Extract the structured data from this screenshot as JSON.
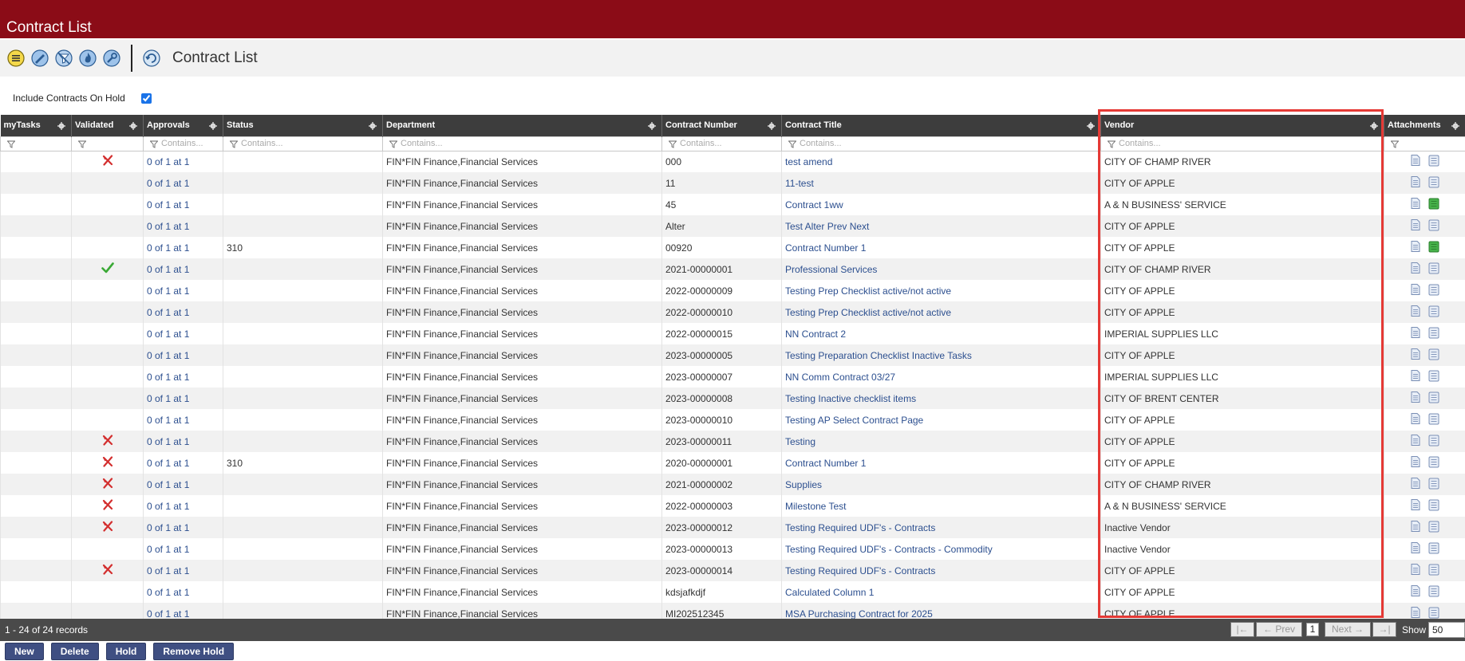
{
  "app": {
    "title": "Contract List"
  },
  "toolbar": {
    "title": "Contract List",
    "icons": [
      "list-icon",
      "edit-pencil-icon",
      "clear-filter-icon",
      "flame-icon",
      "wrench-icon",
      "refresh-icon"
    ]
  },
  "options": {
    "include_on_hold_label": "Include Contracts On Hold",
    "include_on_hold_checked": true
  },
  "grid": {
    "columns": [
      "myTasks",
      "Validated",
      "Approvals",
      "Status",
      "Department",
      "Contract Number",
      "Contract Title",
      "Vendor",
      "Attachments"
    ],
    "filter_placeholder": "Contains...",
    "rows": [
      {
        "validated": "x",
        "approvals": "0 of 1 at 1",
        "status": "",
        "department": "FIN*FIN Finance,Financial Services",
        "number": "000",
        "title": "test amend",
        "vendor": "CITY OF CHAMP RIVER",
        "att2": "gray"
      },
      {
        "validated": "",
        "approvals": "0 of 1 at 1",
        "status": "",
        "department": "FIN*FIN Finance,Financial Services",
        "number": "11",
        "title": "11-test",
        "vendor": "CITY OF APPLE",
        "att2": "gray"
      },
      {
        "validated": "",
        "approvals": "0 of 1 at 1",
        "status": "",
        "department": "FIN*FIN Finance,Financial Services",
        "number": "45",
        "title": "Contract 1ww",
        "vendor": "A & N BUSINESS' SERVICE",
        "att2": "green"
      },
      {
        "validated": "",
        "approvals": "0 of 1 at 1",
        "status": "",
        "department": "FIN*FIN Finance,Financial Services",
        "number": "Alter",
        "title": "Test Alter Prev Next",
        "vendor": "CITY OF APPLE",
        "att2": "gray"
      },
      {
        "validated": "",
        "approvals": "0 of 1 at 1",
        "status": "310",
        "department": "FIN*FIN Finance,Financial Services",
        "number": "00920",
        "title": "Contract Number 1",
        "vendor": "CITY OF APPLE",
        "att2": "green"
      },
      {
        "validated": "check",
        "approvals": "0 of 1 at 1",
        "status": "",
        "department": "FIN*FIN Finance,Financial Services",
        "number": "2021-00000001",
        "title": "Professional Services",
        "vendor": "CITY OF CHAMP RIVER",
        "att2": "gray"
      },
      {
        "validated": "",
        "approvals": "0 of 1 at 1",
        "status": "",
        "department": "FIN*FIN Finance,Financial Services",
        "number": "2022-00000009",
        "title": "Testing Prep Checklist active/not active",
        "vendor": "CITY OF APPLE",
        "att2": "gray"
      },
      {
        "validated": "",
        "approvals": "0 of 1 at 1",
        "status": "",
        "department": "FIN*FIN Finance,Financial Services",
        "number": "2022-00000010",
        "title": "Testing Prep Checklist active/not active",
        "vendor": "CITY OF APPLE",
        "att2": "gray"
      },
      {
        "validated": "",
        "approvals": "0 of 1 at 1",
        "status": "",
        "department": "FIN*FIN Finance,Financial Services",
        "number": "2022-00000015",
        "title": "NN Contract 2",
        "vendor": "IMPERIAL SUPPLIES LLC",
        "att2": "gray"
      },
      {
        "validated": "",
        "approvals": "0 of 1 at 1",
        "status": "",
        "department": "FIN*FIN Finance,Financial Services",
        "number": "2023-00000005",
        "title": "Testing Preparation Checklist Inactive Tasks",
        "vendor": "CITY OF APPLE",
        "att2": "gray"
      },
      {
        "validated": "",
        "approvals": "0 of 1 at 1",
        "status": "",
        "department": "FIN*FIN Finance,Financial Services",
        "number": "2023-00000007",
        "title": "NN Comm Contract 03/27",
        "vendor": "IMPERIAL SUPPLIES LLC",
        "att2": "gray"
      },
      {
        "validated": "",
        "approvals": "0 of 1 at 1",
        "status": "",
        "department": "FIN*FIN Finance,Financial Services",
        "number": "2023-00000008",
        "title": "Testing Inactive checklist items",
        "vendor": "CITY OF BRENT CENTER",
        "att2": "gray"
      },
      {
        "validated": "",
        "approvals": "0 of 1 at 1",
        "status": "",
        "department": "FIN*FIN Finance,Financial Services",
        "number": "2023-00000010",
        "title": "Testing AP Select Contract Page",
        "vendor": "CITY OF APPLE",
        "att2": "gray"
      },
      {
        "validated": "x",
        "approvals": "0 of 1 at 1",
        "status": "",
        "department": "FIN*FIN Finance,Financial Services",
        "number": "2023-00000011",
        "title": "Testing",
        "vendor": "CITY OF APPLE",
        "att2": "gray"
      },
      {
        "validated": "x",
        "approvals": "0 of 1 at 1",
        "status": "310",
        "department": "FIN*FIN Finance,Financial Services",
        "number": "2020-00000001",
        "title": "Contract Number 1",
        "vendor": "CITY OF APPLE",
        "att2": "gray"
      },
      {
        "validated": "x",
        "approvals": "0 of 1 at 1",
        "status": "",
        "department": "FIN*FIN Finance,Financial Services",
        "number": "2021-00000002",
        "title": "Supplies",
        "vendor": "CITY OF CHAMP RIVER",
        "att2": "gray"
      },
      {
        "validated": "x",
        "approvals": "0 of 1 at 1",
        "status": "",
        "department": "FIN*FIN Finance,Financial Services",
        "number": "2022-00000003",
        "title": "Milestone Test",
        "vendor": "A & N BUSINESS' SERVICE",
        "att2": "gray"
      },
      {
        "validated": "x",
        "approvals": "0 of 1 at 1",
        "status": "",
        "department": "FIN*FIN Finance,Financial Services",
        "number": "2023-00000012",
        "title": "Testing Required UDF's - Contracts",
        "vendor": "Inactive Vendor",
        "att2": "gray"
      },
      {
        "validated": "",
        "approvals": "0 of 1 at 1",
        "status": "",
        "department": "FIN*FIN Finance,Financial Services",
        "number": "2023-00000013",
        "title": "Testing Required UDF's - Contracts - Commodity",
        "vendor": "Inactive Vendor",
        "att2": "gray"
      },
      {
        "validated": "x",
        "approvals": "0 of 1 at 1",
        "status": "",
        "department": "FIN*FIN Finance,Financial Services",
        "number": "2023-00000014",
        "title": "Testing Required UDF's - Contracts",
        "vendor": "CITY OF APPLE",
        "att2": "gray"
      },
      {
        "validated": "",
        "approvals": "0 of 1 at 1",
        "status": "",
        "department": "FIN*FIN Finance,Financial Services",
        "number": "kdsjafkdjf",
        "title": "Calculated Column 1",
        "vendor": "CITY OF APPLE",
        "att2": "gray"
      },
      {
        "validated": "",
        "approvals": "0 of 1 at 1",
        "status": "",
        "department": "FIN*FIN Finance,Financial Services",
        "number": "MI202512345",
        "title": "MSA Purchasing Contract for 2025",
        "vendor": "CITY OF APPLE",
        "att2": "gray"
      }
    ]
  },
  "pager": {
    "summary": "1 - 24 of 24 records",
    "prev_label": "Prev",
    "next_label": "Next",
    "current_page": "1",
    "show_label": "Show",
    "page_size": "50"
  },
  "actions": {
    "new": "New",
    "delete": "Delete",
    "hold": "Hold",
    "remove_hold": "Remove Hold"
  },
  "colors": {
    "title_bar": "#8b0c17",
    "header": "#3d3d3d",
    "link": "#2c4f8f",
    "button": "#3f4f82",
    "highlight": "#e53935",
    "check": "#3aa935",
    "cross": "#d32f2f"
  }
}
